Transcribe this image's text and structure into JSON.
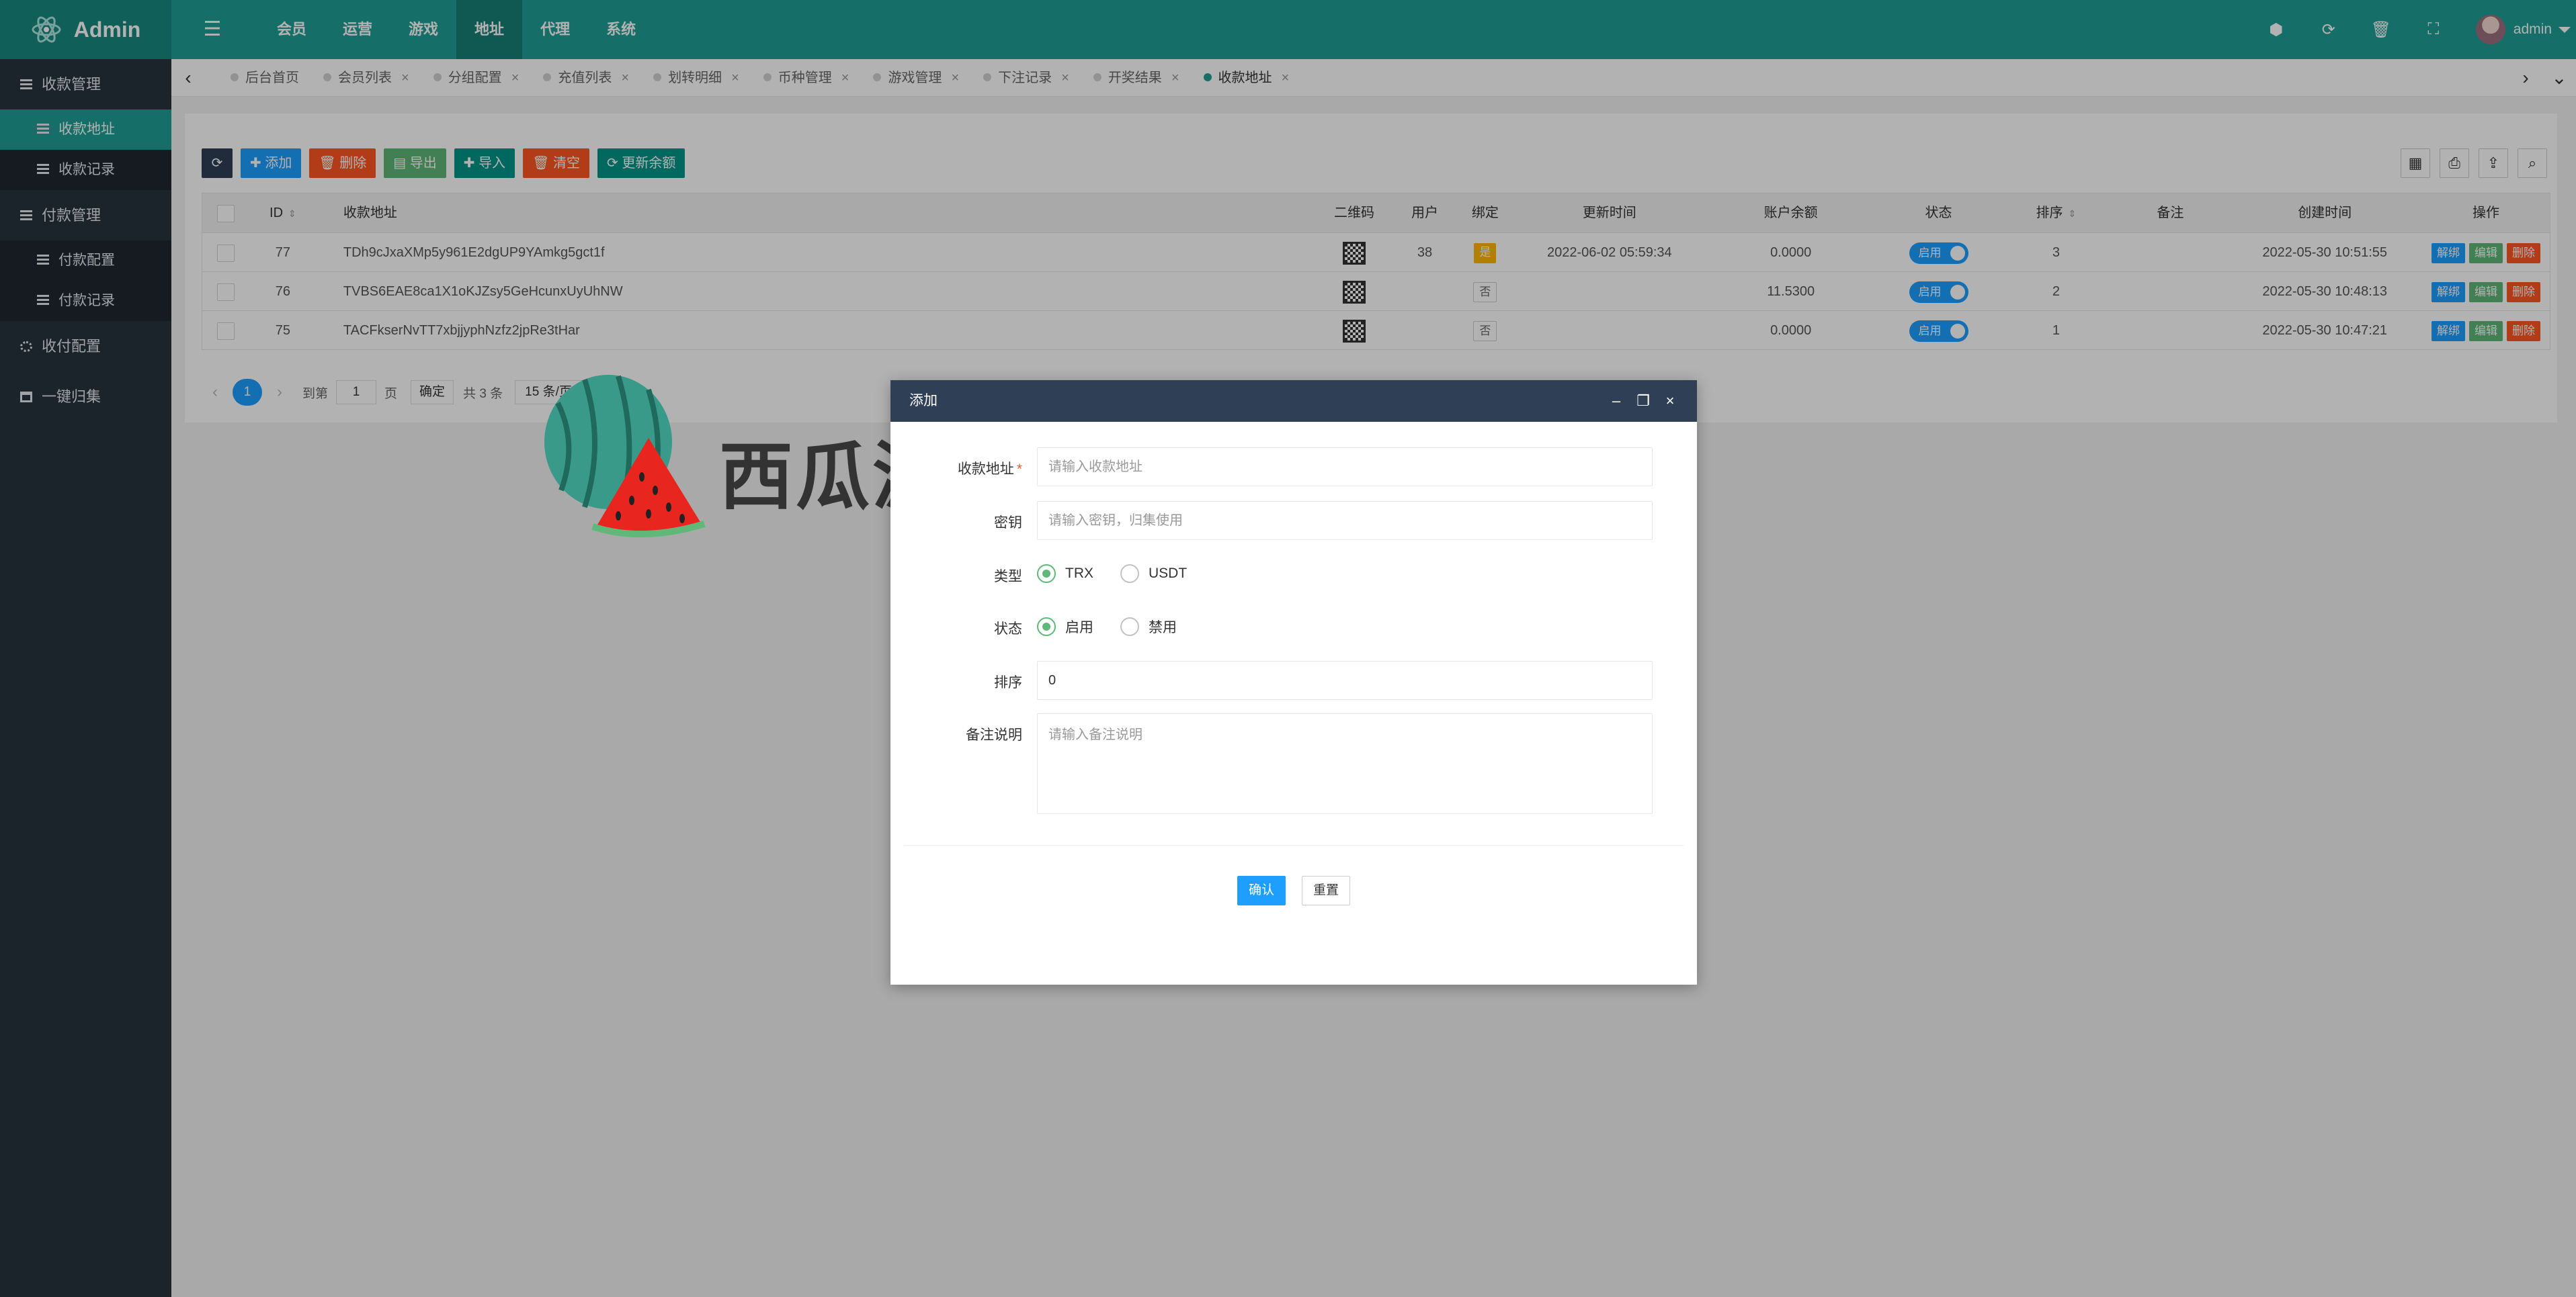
{
  "app": {
    "title": "Admin"
  },
  "topnav": [
    {
      "label": "会员"
    },
    {
      "label": "运营"
    },
    {
      "label": "游戏"
    },
    {
      "label": "地址"
    },
    {
      "label": "代理"
    },
    {
      "label": "系统"
    }
  ],
  "topbar": {
    "user": "admin"
  },
  "sidebar": {
    "groups": [
      {
        "label": "收款管理",
        "items": [
          {
            "label": "收款地址"
          },
          {
            "label": "收款记录"
          }
        ]
      },
      {
        "label": "付款管理",
        "items": [
          {
            "label": "付款配置"
          },
          {
            "label": "付款记录"
          }
        ]
      },
      {
        "label": "收付配置"
      },
      {
        "label": "一键归集"
      }
    ]
  },
  "tabs": [
    {
      "label": "后台首页"
    },
    {
      "label": "会员列表"
    },
    {
      "label": "分组配置"
    },
    {
      "label": "充值列表"
    },
    {
      "label": "划转明细"
    },
    {
      "label": "币种管理"
    },
    {
      "label": "游戏管理"
    },
    {
      "label": "下注记录"
    },
    {
      "label": "开奖结果"
    },
    {
      "label": "收款地址"
    }
  ],
  "toolbar": {
    "add": "添加",
    "delete": "删除",
    "export": "导出",
    "import": "导入",
    "clear": "清空",
    "update_balance": "更新余额"
  },
  "table": {
    "headers": {
      "id": "ID",
      "address": "收款地址",
      "qrcode": "二维码",
      "user": "用户",
      "bind": "绑定",
      "updated": "更新时间",
      "balance": "账户余额",
      "status": "状态",
      "sort": "排序",
      "note": "备注",
      "created": "创建时间",
      "actions": "操作"
    },
    "rows": [
      {
        "id": "77",
        "address": "TDh9cJxaXMp5y961E2dgUP9YAmkg5gct1f",
        "user": "38",
        "bind": "是",
        "updated": "2022-06-02 05:59:34",
        "balance": "0.0000",
        "status": "启用",
        "sort": "3",
        "note": "",
        "created": "2022-05-30 10:51:55"
      },
      {
        "id": "76",
        "address": "TVBS6EAE8ca1X1oKJZsy5GeHcunxUyUhNW",
        "user": "",
        "bind": "否",
        "updated": "",
        "balance": "11.5300",
        "status": "启用",
        "sort": "2",
        "note": "",
        "created": "2022-05-30 10:48:13"
      },
      {
        "id": "75",
        "address": "TACFkserNvTT7xbjjyphNzfz2jpRe3tHar",
        "user": "",
        "bind": "否",
        "updated": "",
        "balance": "0.0000",
        "status": "启用",
        "sort": "1",
        "note": "",
        "created": "2022-05-30 10:47:21"
      }
    ],
    "row_actions": {
      "unbind": "解绑",
      "edit": "编辑",
      "delete": "删除"
    }
  },
  "pager": {
    "current": "1",
    "goto_label": "到第",
    "goto_value": "1",
    "page_unit": "页",
    "confirm": "确定",
    "total": "共 3 条",
    "page_size": "15 条/页"
  },
  "watermark": {
    "text": "西瓜源码"
  },
  "modal": {
    "title": "添加",
    "fields": {
      "address": {
        "label": "收款地址",
        "placeholder": "请输入收款地址"
      },
      "secret": {
        "label": "密钥",
        "placeholder": "请输入密钥，归集使用"
      },
      "type": {
        "label": "类型",
        "options": [
          "TRX",
          "USDT"
        ],
        "selected": "TRX"
      },
      "status": {
        "label": "状态",
        "options": [
          "启用",
          "禁用"
        ],
        "selected": "启用"
      },
      "sort": {
        "label": "排序",
        "value": "0"
      },
      "note": {
        "label": "备注说明",
        "placeholder": "请输入备注说明"
      }
    },
    "confirm": "确认",
    "reset": "重置"
  },
  "colors": {
    "primary": "#1fa095",
    "sidebar": "#28333e",
    "blue": "#1e9fff",
    "header_dark": "#2f4056"
  }
}
